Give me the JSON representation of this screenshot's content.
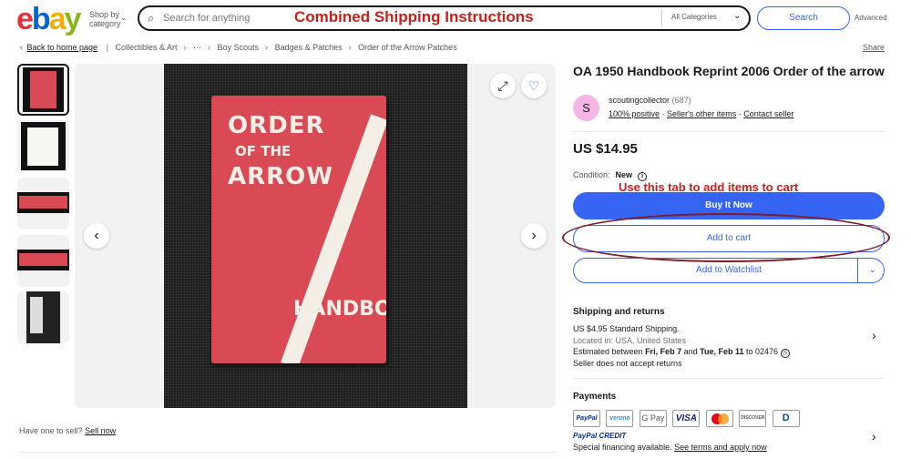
{
  "header": {
    "logo": [
      "e",
      "b",
      "a",
      "y"
    ],
    "shop_by_line1": "Shop by",
    "shop_by_line2": "category",
    "search_placeholder": "Search for anything",
    "search_overlay": "Combined Shipping Instructions",
    "category": "All Categories",
    "search_button": "Search",
    "advanced": "Advanced"
  },
  "breadcrumb": {
    "back": "Back to home page",
    "items": [
      "Collectibles & Art",
      "···",
      "Boy Scouts",
      "Badges & Patches",
      "Order of the Arrow Patches"
    ],
    "share": "Share"
  },
  "gallery": {
    "book_lines": [
      "ORDER",
      "OF THE",
      "ARROW",
      "HANDBOOK"
    ],
    "sell_prompt": "Have one to sell?",
    "sell_link": "Sell now"
  },
  "listing": {
    "title": "OA 1950 Handbook Reprint 2006 Order of the arrow",
    "seller_initial": "S",
    "seller_name": "scoutingcollector",
    "seller_count": "(687)",
    "positive": "100% positive",
    "other_items": "Seller's other items",
    "contact": "Contact seller",
    "price": "US $14.95",
    "condition_label": "Condition:",
    "condition_value": "New",
    "annotation": "Use this tab to add items to cart",
    "buy_now": "Buy It Now",
    "add_to_cart": "Add to cart",
    "watchlist": "Add to Watchlist"
  },
  "shipping": {
    "heading": "Shipping and returns",
    "cost": "US $4.95",
    "method": "Standard Shipping.",
    "location": "Located in: USA, United States",
    "est_prefix": "Estimated between",
    "est_from": "Fri, Feb 7",
    "est_and": "and",
    "est_to": "Tue, Feb 11",
    "est_zip": "to 02476",
    "returns": "Seller does not accept returns"
  },
  "payments": {
    "heading": "Payments",
    "methods": [
      "PayPal",
      "venmo",
      "G Pay",
      "VISA",
      "",
      "DISCOVER",
      "D"
    ],
    "ppcredit_a": "PayPal",
    "ppcredit_b": "CREDIT",
    "financing": "Special financing available.",
    "financing_link": "See terms and apply now"
  }
}
